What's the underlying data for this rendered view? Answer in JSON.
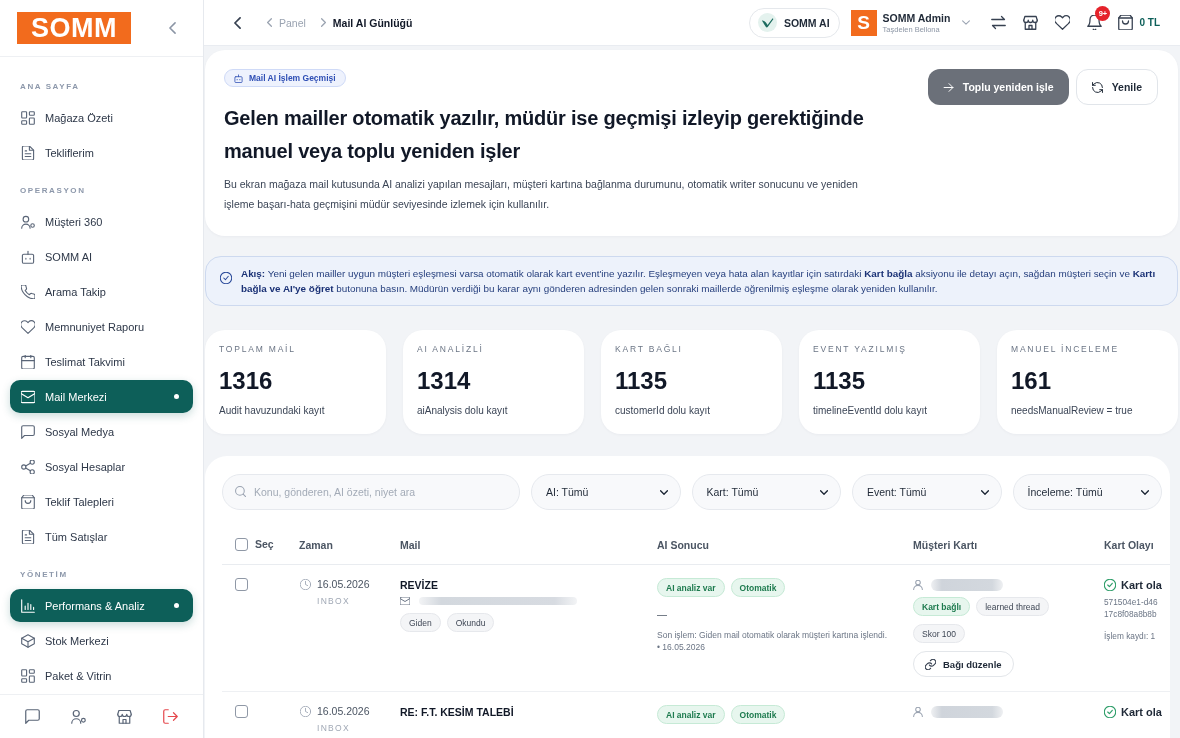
{
  "sidebar": {
    "logo": "SOMM",
    "sections": [
      {
        "title": "ANA SAYFA",
        "items": [
          {
            "label": "Mağaza Özeti",
            "selected": false
          },
          {
            "label": "Tekliflerim",
            "selected": false
          }
        ]
      },
      {
        "title": "OPERASYON",
        "items": [
          {
            "label": "Müşteri 360",
            "selected": false
          },
          {
            "label": "SOMM AI",
            "selected": false
          },
          {
            "label": "Arama Takip",
            "selected": false
          },
          {
            "label": "Memnuniyet Raporu",
            "selected": false
          },
          {
            "label": "Teslimat Takvimi",
            "selected": false
          },
          {
            "label": "Mail Merkezi",
            "selected": true
          },
          {
            "label": "Sosyal Medya",
            "selected": false
          },
          {
            "label": "Sosyal Hesaplar",
            "selected": false
          },
          {
            "label": "Teklif Talepleri",
            "selected": false
          },
          {
            "label": "Tüm Satışlar",
            "selected": false
          }
        ]
      },
      {
        "title": "YÖNETİM",
        "items": [
          {
            "label": "Performans & Analiz",
            "selected": true
          },
          {
            "label": "Stok Merkezi",
            "selected": false
          },
          {
            "label": "Paket & Vitrin",
            "selected": false
          }
        ]
      }
    ]
  },
  "top_bar": {
    "breadcrumb": [
      {
        "label": "Panel",
        "selected": false
      },
      {
        "label": "Mail AI Günlüğü",
        "selected": true
      }
    ],
    "assistant_button": "SOMM AI",
    "user": {
      "avatar": "S",
      "name": "SOMM Admin",
      "store": "Taşdelen Bellona"
    },
    "notification_badge": "9+",
    "cart_total": "0 TL"
  },
  "header": {
    "badge": "Mail AI İşlem Geçmişi",
    "title": "Gelen mailler otomatik yazılır, müdür ise geçmişi izleyip gerektiğinde manuel veya toplu yeniden işler",
    "description": "Bu ekran mağaza mail kutusunda AI analizi yapılan mesajları, müşteri kartına bağlanma durumunu, otomatik writer sonucunu ve yeniden işleme başarı-hata geçmişini müdür seviyesinde izlemek için kullanılır.",
    "buttons": [
      {
        "label": "Toplu yeniden işle",
        "kind": "primary"
      },
      {
        "label": "Yenile",
        "kind": "secondary"
      }
    ]
  },
  "info_banner": {
    "text": "**Akış:** Yeni gelen mailler uygun müşteri eşleşmesi varsa otomatik olarak kart event'ine yazılır. Eşleşmeyen veya hata alan kayıtlar için satırdaki **Kart bağla** aksiyonu ile detayı açın, sağdan müşteri seçin ve **Kartı bağla ve AI'ye öğret** butonuna basın. Müdürün verdiği bu karar aynı gönderen adresinden gelen sonraki maillerde öğrenilmiş eşleşme olarak yeniden kullanılır."
  },
  "stats": [
    {
      "label": "TOPLAM MAİL",
      "value": "1316",
      "caption": "Audit havuzundaki kayıt"
    },
    {
      "label": "AI ANALİZLİ",
      "value": "1314",
      "caption": "aiAnalysis dolu kayıt"
    },
    {
      "label": "KART BAĞLI",
      "value": "1135",
      "caption": "customerId dolu kayıt"
    },
    {
      "label": "EVENT YAZILMIŞ",
      "value": "1135",
      "caption": "timelineEventId dolu kayıt"
    },
    {
      "label": "MANUEL İNCELEME",
      "value": "161",
      "caption": "needsManualReview = true"
    }
  ],
  "filters": {
    "search_placeholder": "Konu, gönderen, AI özeti, niyet ara",
    "selects": [
      "AI: Tümü",
      "Kart: Tümü",
      "Event: Tümü",
      "İnceleme: Tümü"
    ]
  },
  "table": {
    "select_all": {
      "label": "Seç",
      "checked": false
    },
    "columns": [
      "Zaman",
      "Mail",
      "AI Sonucu",
      "Müşteri Kartı",
      "Kart Olayı"
    ],
    "rows": [
      {
        "checked": false,
        "date": "16.05.2026",
        "folder": "INBOX",
        "subject": "REVİZE",
        "sender_blurred": true,
        "tags": [
          {
            "label": "Giden",
            "kind": "neutral"
          },
          {
            "label": "Okundu",
            "kind": "neutral"
          }
        ],
        "ai_tags": [
          {
            "label": "AI analiz var",
            "kind": "success"
          },
          {
            "label": "Otomatik",
            "kind": "success"
          }
        ],
        "ai_summary": "—",
        "last_action": "Son işlem: Giden mail otomatik olarak müşteri kartına işlendi. • 16.05.2026",
        "customer_blurred": true,
        "card_tags": [
          {
            "label": "Kart bağlı",
            "kind": "success"
          },
          {
            "label": "learned thread",
            "kind": "neutral"
          },
          {
            "label": "Skor 100",
            "kind": "neutral"
          }
        ],
        "card_action": "Bağı düzenle",
        "event": {
          "kind": "success",
          "status": "Kart ola",
          "ids": [
            "571504e1-d46",
            "17c8f08a8b8b"
          ],
          "log": "İşlem kaydı: 1"
        }
      },
      {
        "checked": false,
        "date": "16.05.2026",
        "folder": "INBOX",
        "subject": "RE: F.T. KESİM TALEBİ",
        "ai_tags": [
          {
            "label": "AI analiz var",
            "kind": "success"
          },
          {
            "label": "Otomatik",
            "kind": "success"
          }
        ],
        "customer_blurred": true,
        "event": {
          "kind": "success",
          "status": "Kart ola"
        }
      }
    ]
  }
}
